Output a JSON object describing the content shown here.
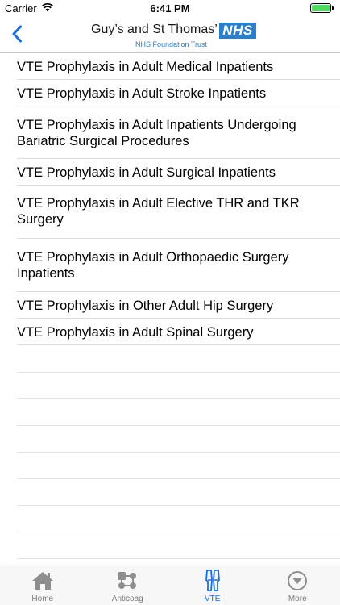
{
  "status_bar": {
    "carrier": "Carrier",
    "time": "6:41 PM",
    "battery_level": 1.0
  },
  "nav_bar": {
    "back_icon": "chevron-left-icon",
    "logo": {
      "name": "Guy’s and St Thomas’",
      "badge": "NHS",
      "subtitle": "NHS Foundation Trust"
    }
  },
  "list": {
    "items": [
      {
        "label": "VTE Prophylaxis in Adult Medical Inpatients"
      },
      {
        "label": "VTE Prophylaxis in Adult Stroke Inpatients"
      },
      {
        "label": "VTE Prophylaxis in Adult Inpatients Undergoing Bariatric Surgical Procedures"
      },
      {
        "label": "VTE Prophylaxis in Adult Surgical Inpatients"
      },
      {
        "label": "VTE Prophylaxis in Adult Elective THR and TKR Surgery"
      },
      {
        "label": "VTE Prophylaxis in Adult Orthopaedic Surgery Inpatients"
      },
      {
        "label": "VTE Prophylaxis in Other Adult Hip Surgery"
      },
      {
        "label": "VTE Prophylaxis in Adult Spinal Surgery"
      }
    ]
  },
  "tab_bar": {
    "tabs": [
      {
        "label": "Home",
        "icon": "home-icon",
        "active": false
      },
      {
        "label": "Anticoag",
        "icon": "anticoag-icon",
        "active": false
      },
      {
        "label": "VTE",
        "icon": "vte-legs-icon",
        "active": true
      },
      {
        "label": "More",
        "icon": "more-chevron-circle-icon",
        "active": false
      }
    ]
  },
  "colors": {
    "accent": "#1a6fe0",
    "nhs_blue": "#2d7ec8",
    "battery": "#4cd964"
  }
}
